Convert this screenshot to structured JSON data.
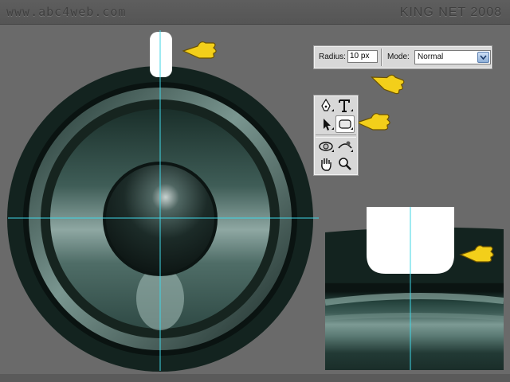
{
  "header": {
    "site": "www.abc4web.com",
    "brand": "KING NET 2008"
  },
  "options_bar": {
    "radius_label": "Radius:",
    "radius_value": "10 px",
    "mode_label": "Mode:",
    "mode_value": "Normal"
  },
  "toolbox": {
    "tools": [
      "pen-tool",
      "type-tool",
      "path-selection-tool",
      "rounded-rectangle-tool",
      "3d-orbit-tool",
      "3d-roll-tool",
      "hand-tool",
      "zoom-tool"
    ],
    "selected": "rounded-rectangle-tool"
  },
  "colors": {
    "guide": "#3fd6e6",
    "speaker_dark": "#13231f",
    "speaker_mid": "#4f6c66",
    "background": "#6a6a6a"
  }
}
